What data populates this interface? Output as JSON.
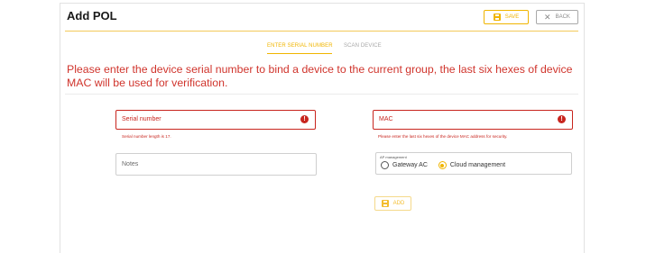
{
  "page": {
    "title": "Add POL"
  },
  "toolbar": {
    "save_label": "SAVE",
    "back_label": "BACK"
  },
  "tabs": [
    {
      "label": "ENTER SERIAL NUMBER",
      "active": true
    },
    {
      "label": "SCAN DEVICE",
      "active": false
    }
  ],
  "instructions": "Please enter the device serial number to bind a device to the current group, the last six hexes of device MAC will be used for verification.",
  "form": {
    "serial": {
      "label": "Serial number",
      "error": "Serial number length is 17.",
      "value": ""
    },
    "mac": {
      "label": "MAC",
      "error": "Please enter the last six hexes of the device MAC address for security.",
      "value": ""
    },
    "notes": {
      "label": "Notes",
      "value": ""
    },
    "ap_management": {
      "legend": "AP management",
      "options": [
        {
          "label": "Gateway AC",
          "selected": false
        },
        {
          "label": "Cloud management",
          "selected": true
        }
      ]
    },
    "add_label": "ADD"
  },
  "colors": {
    "accent": "#f0b500",
    "error": "#c8251e",
    "instructions": "#d0342c"
  },
  "icons": {
    "save": "save-disk-icon",
    "back": "close-icon",
    "error": "alert-circle-icon",
    "add": "save-disk-icon"
  }
}
